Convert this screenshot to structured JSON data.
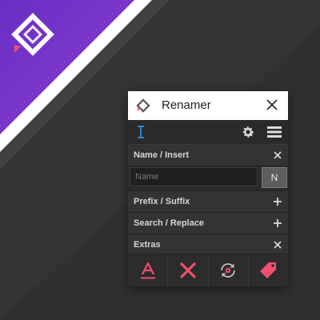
{
  "window": {
    "title": "Renamer",
    "app_icon": "renamer-logo-icon"
  },
  "toolbar": {
    "left_icon": "text-cursor-icon",
    "settings_icon": "gear-icon",
    "menu_icon": "menu-icon"
  },
  "sections": {
    "name_insert": {
      "label": "Name / Insert",
      "state": "expanded"
    },
    "prefix_suffix": {
      "label": "Prefix / Suffix",
      "state": "collapsed"
    },
    "search_replace": {
      "label": "Search / Replace",
      "state": "collapsed"
    },
    "extras": {
      "label": "Extras",
      "state": "expanded"
    }
  },
  "name_field": {
    "placeholder": "Name",
    "value": ""
  },
  "n_button": {
    "label": "N"
  },
  "extras_actions": [
    "text-case-icon",
    "close-icon",
    "refresh-settings-icon",
    "tag-icon"
  ],
  "colors": {
    "accent_blue": "#2a9df4",
    "accent_pink": "#f0506e",
    "purple": "#7b35c8",
    "panel_dark": "#2b2b2b"
  }
}
